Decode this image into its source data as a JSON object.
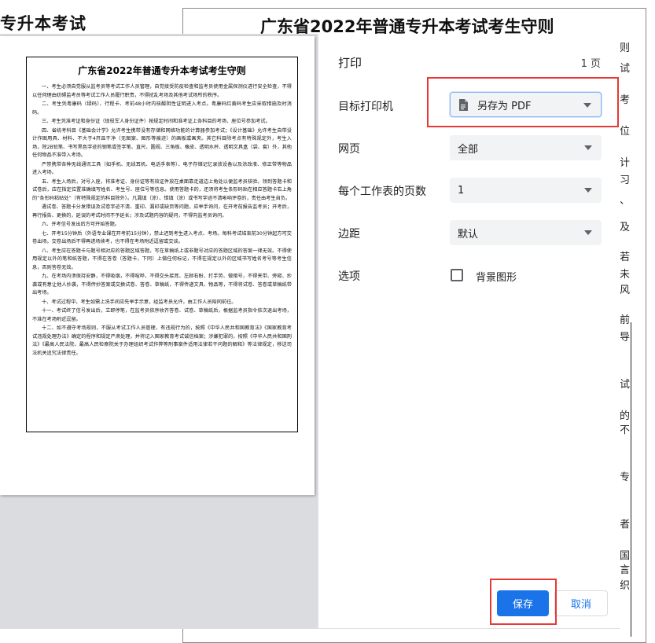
{
  "background": {
    "left_title": "专升本考试",
    "right_title": "广东省2022年普通专升本考试考生守则",
    "right_edge_chars": [
      "则",
      "试",
      "考",
      "位",
      "计",
      "习",
      "、",
      "及",
      "若",
      "未",
      "风",
      "前",
      "导",
      "试",
      "的",
      "不",
      "专",
      "者",
      "国",
      "言",
      "织"
    ]
  },
  "preview": {
    "title": "广东省2022年普通专升本考试考生守则",
    "paragraphs": [
      "一、考生必须自觉服从监考员等考试工作人员管理，自觉接受防疫检查和监考员使用金属探测仪进行安全检查，不得以任何理由妨碍监考员等考试工作人员履行职责，不得扰乱考场及其他考试场所的秩序。",
      "二、考生凭粤康码（绿码）、行程卡、考前48小时内核酸阴性证明进入考点。粤康码红黄码考生应采取措施及时消码。",
      "三、考生凭准考证和身份证（现役军人身份证件）按规定时间和准考证上各科目的考场、座位号参加考试。",
      "四、省统考科目《基础会计学》允许考生携带没有存储和网络功能的计算器参加考试；《设计基础》允许考生自带设计作图用具、材料、不大于4开且干净（无图案、图形等痕迹）的画板或画夹。其它科目除考点有特殊规定外，考生入场，除2B铅笔、书写黑色字迹的钢笔或签字笔、直尺、圆规、三角板、橡皮、透明水杯、透明文具盒（袋、套）外，其他任何物品不准带入考场。",
      "严禁携带各种无线通讯工具（如手机、无线耳机、电话手表等）、电子存储记忆录放设备以及涂改液、修正带等物品进入考场。",
      "五、考生入场后，对号入座，将准考证、身份证等有效证件放在桌面靠走道边上角处以便监考员核验。领到答题卡和试卷后，应在指定位置准确填写姓名、考生号、座位号等信息。使用答题卡的，还须将考生条形码贴在相应答题卡右上角的“条形码粘贴处”（有特殊规定的科目除外）。凡漏填（涂）、错填（涂）或书写字迹不清晰响评卷的，责任由考生自负。",
      "遇试卷、答题卡分发错误及试卷字迹不清、重印、漏印或缺页等问题，应举手询问，在开考前报告监考员；开考后，再行报告、更换的，延误的考试时间不予延长；涉及试题内容的疑问，不得向监考员询问。",
      "六、开考信号发出后方可开始答题。",
      "七、开考15分钟后（外语专业课在开考前15分钟），禁止迟到考生进入考点、考场。每科考试结束前30分钟起方可交卷出场。交卷出场后不得再进场续考，也不得在考场附近逗留或交谈。",
      "八、考生应在答题卡与题号相对应的答题区域答题，写在草稿纸上或非题号对应的答题区域的答案一律无效。不得使用规定以外的笔和纸答题，不得在答卷（答题卡，下同）上做任何标记，不得在规定以外的区域书写姓名考号等考生信息，否则答卷无效。",
      "九、在考场内须保持安静，不得吸烟，不得喧哗，不得交头接耳、左顾右盼、打手势、做暗号，不得夹带、旁窥、抄袭或有意让他人抄袭，不得传抄答案或交换试卷、答卷、草稿纸，不得传递文具、物品等，不得将试卷、答卷或草稿纸带出考场。",
      "十、考试过程中，考生如需上洗手间应先举手示意，经监考员允许，由工作人员陪同前往。",
      "十一、考试终了信号发出后，立即停笔，在监考员依序收齐答卷、试卷、草稿纸后，根据监考员指令依次退出考场，不准在考场附近逗留。",
      "十二、如不遵守考场规则，不服从考试工作人员管理，有违规行为的，按照《中华人民共和国教育法》《国家教育考试违规处理办法》确定的程序和规定严肃处理，并将记入国家教育考试诚信档案；涉嫌犯罪的，按照《中华人民共和国刑法》《最高人民法院、最高人民检察院关于办理组织考试作弊等刑事案件适用法律若干问题的解释》等法律规定，移送司法机关追究法律责任。"
    ]
  },
  "dialog": {
    "title": "打印",
    "page_count": "1 页",
    "destination_label": "目标打印机",
    "destination_value": "另存为 PDF",
    "pages_label": "网页",
    "pages_value": "全部",
    "pages_per_sheet_label": "每个工作表的页数",
    "pages_per_sheet_value": "1",
    "margins_label": "边距",
    "margins_value": "默认",
    "options_label": "选项",
    "background_graphics_label": "背景图形",
    "background_graphics_checked": false,
    "save_label": "保存",
    "cancel_label": "取消"
  },
  "colors": {
    "primary": "#1a73e8",
    "annotation": "#e53935",
    "select_bg": "#f1f3f4",
    "preview_bg": "#dadce0"
  }
}
